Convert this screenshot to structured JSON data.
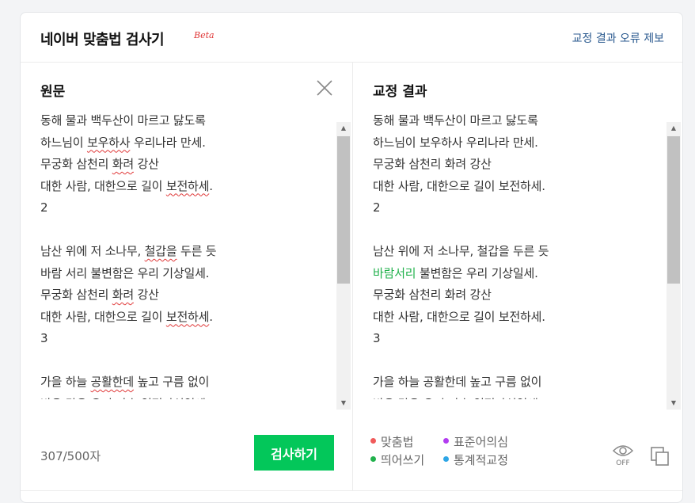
{
  "header": {
    "title": "네이버 맞춤법 검사기",
    "beta": "Beta",
    "report_link": "교정 결과 오류 제보"
  },
  "original": {
    "title": "원문",
    "lines": [
      [
        {
          "t": "동해 물과 백두산이 마르고 닳도록"
        }
      ],
      [
        {
          "t": "하느님이 "
        },
        {
          "t": "보우하사",
          "e": "err"
        },
        {
          "t": " 우리나라 만세."
        }
      ],
      [
        {
          "t": "무궁화 삼천리 "
        },
        {
          "t": "화려",
          "e": "err"
        },
        {
          "t": " 강산"
        }
      ],
      [
        {
          "t": "대한 사람, 대한으로 길이 "
        },
        {
          "t": "보전하세",
          "e": "err"
        },
        {
          "t": "."
        }
      ],
      [
        {
          "t": "2"
        }
      ],
      [
        {
          "t": ""
        }
      ],
      [
        {
          "t": "남산 위에 저 소나무, "
        },
        {
          "t": "철갑을",
          "e": "err"
        },
        {
          "t": " 두른 듯"
        }
      ],
      [
        {
          "t": "바람 서리 불변함은 우리 기상일세."
        }
      ],
      [
        {
          "t": "무궁화 삼천리 "
        },
        {
          "t": "화려",
          "e": "err"
        },
        {
          "t": " 강산"
        }
      ],
      [
        {
          "t": "대한 사람, 대한으로 길이 "
        },
        {
          "t": "보전하세",
          "e": "err"
        },
        {
          "t": "."
        }
      ],
      [
        {
          "t": "3"
        }
      ],
      [
        {
          "t": ""
        }
      ],
      [
        {
          "t": "가을 하늘 "
        },
        {
          "t": "공활한데",
          "e": "err"
        },
        {
          "t": " 높고 구름 없이"
        }
      ],
      [
        {
          "t": "밝은 달은 우리 가슴 일편단심일세."
        }
      ]
    ],
    "counter": "307/500자",
    "check_button": "검사하기"
  },
  "result": {
    "title": "교정 결과",
    "lines": [
      [
        {
          "t": "동해 물과 백두산이 마르고 닳도록"
        }
      ],
      [
        {
          "t": "하느님이 보우하사 우리나라 만세."
        }
      ],
      [
        {
          "t": "무궁화 삼천리 화려 강산"
        }
      ],
      [
        {
          "t": "대한 사람, 대한으로 길이 보전하세."
        }
      ],
      [
        {
          "t": "2"
        }
      ],
      [
        {
          "t": ""
        }
      ],
      [
        {
          "t": "남산 위에 저 소나무, 철갑을 두른 듯"
        }
      ],
      [
        {
          "t": "바람서리",
          "e": "fix-green"
        },
        {
          "t": " 불변함은 우리 기상일세."
        }
      ],
      [
        {
          "t": "무궁화 삼천리 화려 강산"
        }
      ],
      [
        {
          "t": "대한 사람, 대한으로 길이 보전하세."
        }
      ],
      [
        {
          "t": "3"
        }
      ],
      [
        {
          "t": ""
        }
      ],
      [
        {
          "t": "가을 하늘 공활한데 높고 구름 없이"
        }
      ],
      [
        {
          "t": "밝은 달은 우리 가슴 일편단심일세."
        }
      ]
    ],
    "legend": [
      {
        "label": "맞춤법",
        "color": "#f05a5a"
      },
      {
        "label": "표준어의심",
        "color": "#b23cf0"
      },
      {
        "label": "띄어쓰기",
        "color": "#21b14c"
      },
      {
        "label": "통계적교정",
        "color": "#2ea6e6"
      }
    ],
    "eye_label": "OFF"
  },
  "icons": {
    "close": "close-icon",
    "eye": "eye-icon",
    "copy": "copy-icon"
  }
}
